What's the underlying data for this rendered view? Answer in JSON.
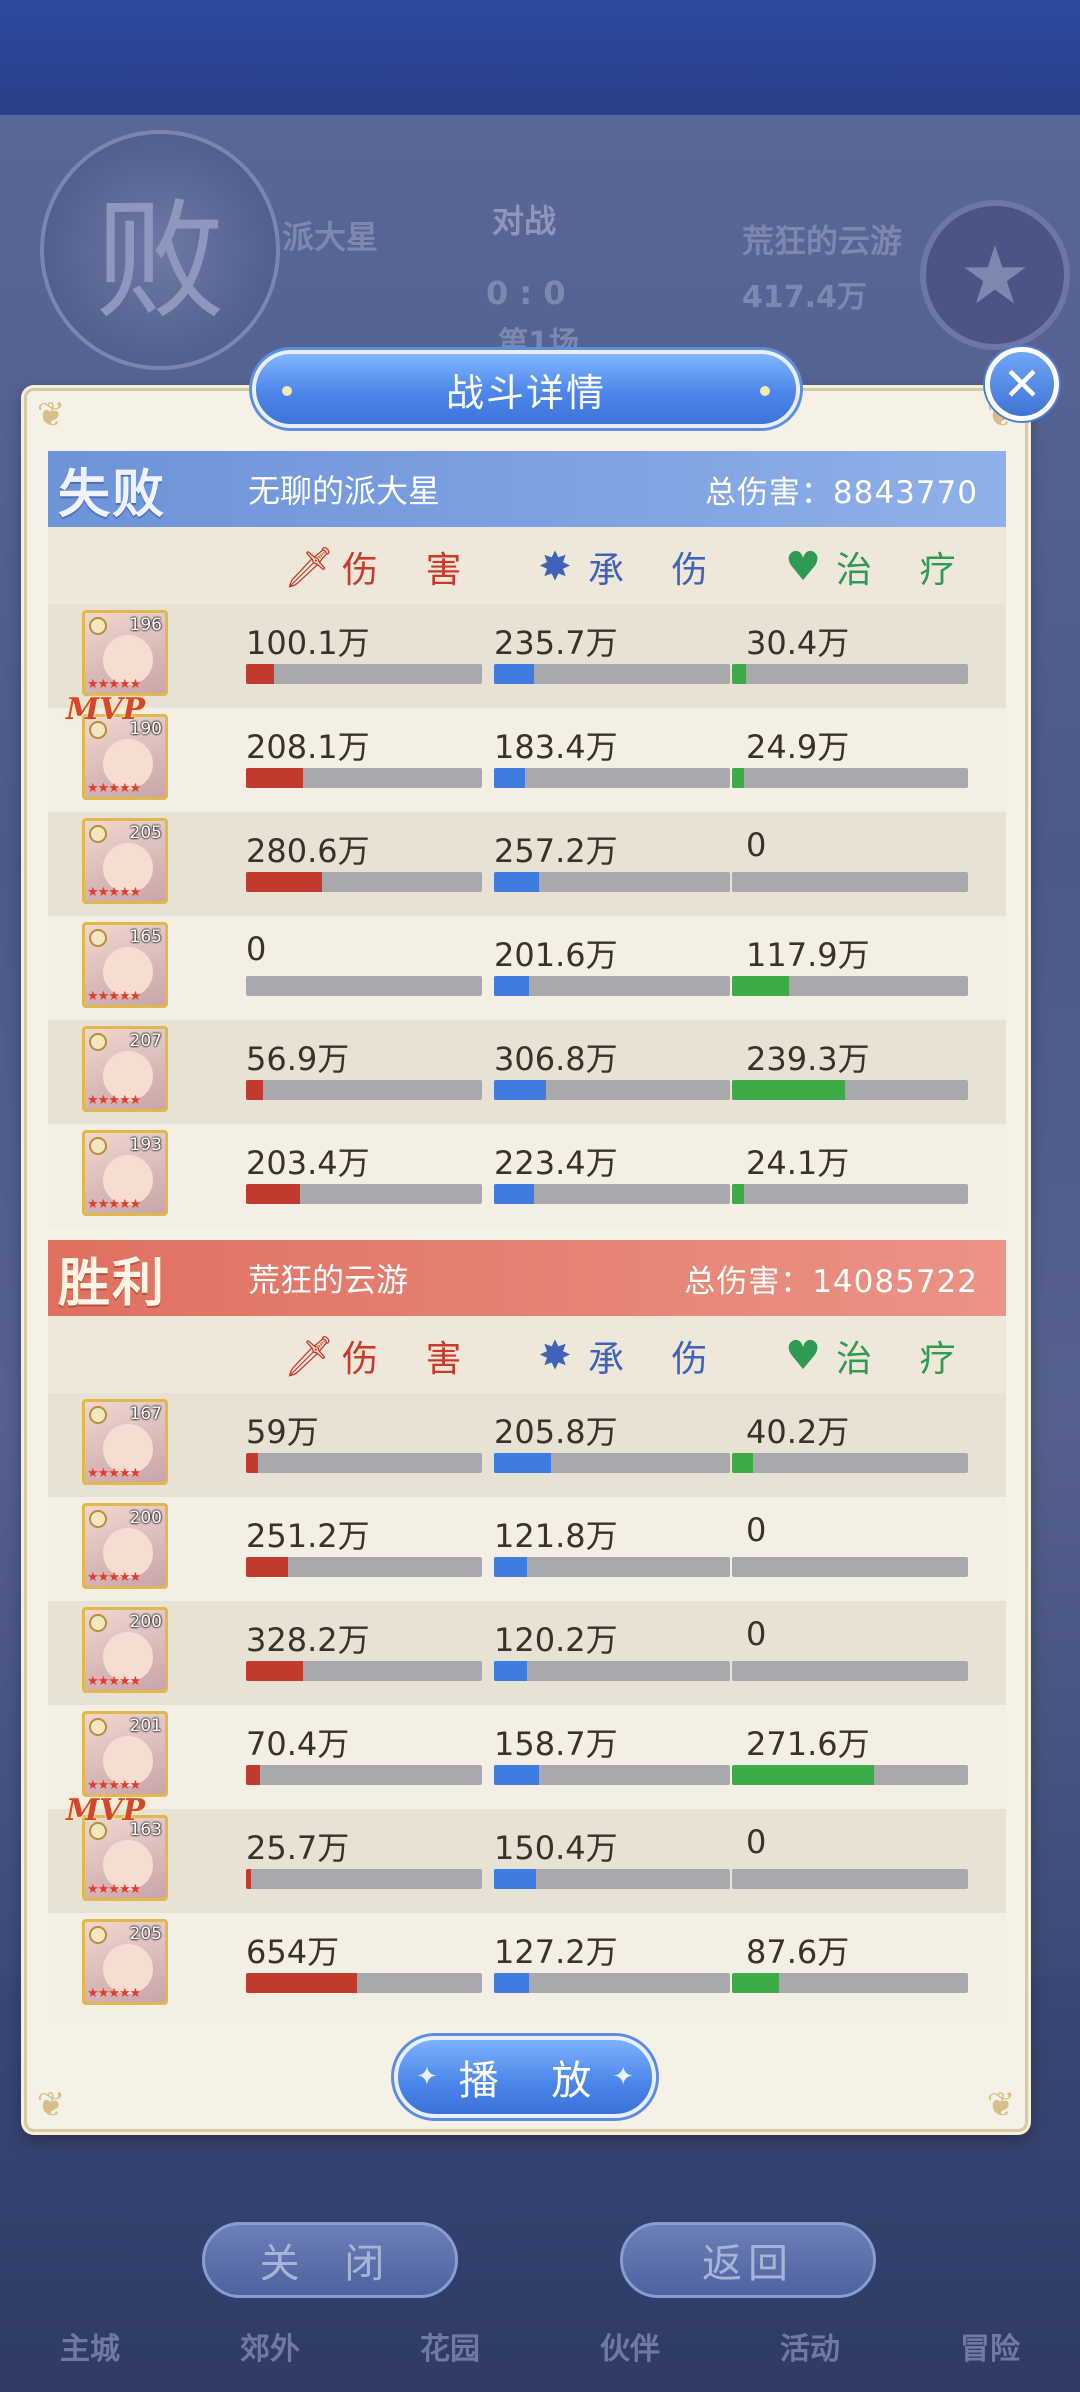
{
  "background": {
    "defeat_seal": "败",
    "player_left": "派大星",
    "vs_label": "对战",
    "player_right": "荒狂的云游",
    "right_power": "417.4万",
    "score": "0 : 0",
    "round": "第1场",
    "close_button": "关 闭",
    "return_button": "返回",
    "nav": [
      "主城",
      "郊外",
      "花园",
      "伙伴",
      "活动",
      "冒险"
    ]
  },
  "dialog": {
    "title": "战斗详情",
    "play_button": "播 放",
    "columns": {
      "damage": "伤 害",
      "taken": "承 伤",
      "heal": "治 疗"
    }
  },
  "teams": [
    {
      "result": "失败",
      "name": "无聊的派大星",
      "total_damage": "总伤害：8843770",
      "members": [
        {
          "level": "196",
          "damage": "100.1万",
          "taken": "235.7万",
          "heal": "30.4万",
          "dmg_ratio": 0.12,
          "taken_ratio": 0.17,
          "heal_ratio": 0.06,
          "mvp": ""
        },
        {
          "level": "190",
          "damage": "208.1万",
          "taken": "183.4万",
          "heal": "24.9万",
          "dmg_ratio": 0.24,
          "taken_ratio": 0.13,
          "heal_ratio": 0.05,
          "mvp": "MVP"
        },
        {
          "level": "205",
          "damage": "280.6万",
          "taken": "257.2万",
          "heal": "0",
          "dmg_ratio": 0.32,
          "taken_ratio": 0.19,
          "heal_ratio": 0.0,
          "mvp": ""
        },
        {
          "level": "165",
          "damage": "0",
          "taken": "201.6万",
          "heal": "117.9万",
          "dmg_ratio": 0.0,
          "taken_ratio": 0.15,
          "heal_ratio": 0.24,
          "mvp": ""
        },
        {
          "level": "207",
          "damage": "56.9万",
          "taken": "306.8万",
          "heal": "239.3万",
          "dmg_ratio": 0.07,
          "taken_ratio": 0.22,
          "heal_ratio": 0.48,
          "mvp": ""
        },
        {
          "level": "193",
          "damage": "203.4万",
          "taken": "223.4万",
          "heal": "24.1万",
          "dmg_ratio": 0.23,
          "taken_ratio": 0.17,
          "heal_ratio": 0.05,
          "mvp": ""
        }
      ]
    },
    {
      "result": "胜利",
      "name": "荒狂的云游",
      "total_damage": "总伤害：14085722",
      "members": [
        {
          "level": "167",
          "damage": "59万",
          "taken": "205.8万",
          "heal": "40.2万",
          "dmg_ratio": 0.05,
          "taken_ratio": 0.24,
          "heal_ratio": 0.09,
          "mvp": ""
        },
        {
          "level": "200",
          "damage": "251.2万",
          "taken": "121.8万",
          "heal": "0",
          "dmg_ratio": 0.18,
          "taken_ratio": 0.14,
          "heal_ratio": 0.0,
          "mvp": ""
        },
        {
          "level": "200",
          "damage": "328.2万",
          "taken": "120.2万",
          "heal": "0",
          "dmg_ratio": 0.24,
          "taken_ratio": 0.14,
          "heal_ratio": 0.0,
          "mvp": ""
        },
        {
          "level": "201",
          "damage": "70.4万",
          "taken": "158.7万",
          "heal": "271.6万",
          "dmg_ratio": 0.06,
          "taken_ratio": 0.19,
          "heal_ratio": 0.6,
          "mvp": ""
        },
        {
          "level": "163",
          "damage": "25.7万",
          "taken": "150.4万",
          "heal": "0",
          "dmg_ratio": 0.02,
          "taken_ratio": 0.18,
          "heal_ratio": 0.0,
          "mvp": "MVP"
        },
        {
          "level": "205",
          "damage": "654万",
          "taken": "127.2万",
          "heal": "87.6万",
          "dmg_ratio": 0.47,
          "taken_ratio": 0.15,
          "heal_ratio": 0.2,
          "mvp": ""
        }
      ]
    }
  ],
  "colors": {
    "damage": "#c23a2e",
    "taken": "#3e7ce0",
    "heal": "#3fab48",
    "lose_header": "#6d93d8",
    "win_header": "#e07060"
  }
}
